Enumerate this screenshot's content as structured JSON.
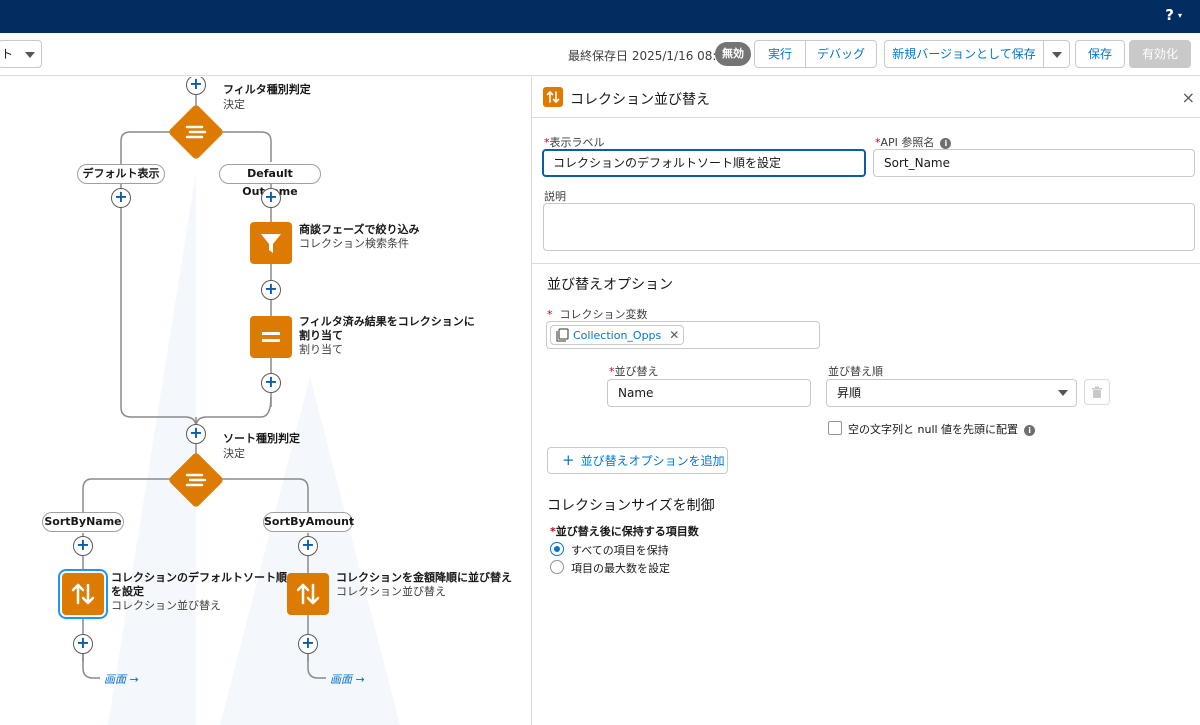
{
  "topbar": {
    "help_label": "?",
    "help_caret": "▾"
  },
  "toolbar": {
    "left_select_text": "ト",
    "last_saved": "最終保存日 2025/1/16 08:55",
    "status_badge": "無効",
    "run_label": "実行",
    "debug_label": "デバッグ",
    "save_new_version_label": "新規バージョンとして保存",
    "save_label": "保存",
    "activate_label": "有効化"
  },
  "canvas": {
    "filter_decision": {
      "title": "フィルタ種別判定",
      "subtitle": "決定"
    },
    "branch_default_display": "デフォルト表示",
    "branch_default_outcome": "Default Outcome",
    "filter_node": {
      "title": "商談フェーズで絞り込み",
      "subtitle": "コレクション検索条件"
    },
    "assign_node": {
      "title_line1": "フィルタ済み結果をコレクションに",
      "title_line2": "割り当て",
      "subtitle": "割り当て"
    },
    "sort_decision": {
      "title": "ソート種別判定",
      "subtitle": "決定"
    },
    "branch_sort_by_name": "SortByName",
    "branch_sort_by_amount": "SortByAmount",
    "sort_name_node": {
      "title_line1": "コレクションのデフォルトソート順",
      "title_line2": "を設定",
      "subtitle": "コレクション並び替え"
    },
    "sort_amount_node": {
      "title": "コレクションを金額降順に並び替え",
      "subtitle": "コレクション並び替え"
    },
    "screen_link_1": "画面 →",
    "screen_link_2": "画面 →",
    "plus_symbol": "+"
  },
  "panel": {
    "title": "コレクション並び替え",
    "close_symbol": "×",
    "label_field": {
      "label": "表示ラベル",
      "value": "コレクションのデフォルトソート順を設定"
    },
    "api_field": {
      "label": "API 参照名",
      "value": "Sort_Name"
    },
    "description_label": "説明",
    "sort_options_title": "並び替えオプション",
    "collection_var_label": "コレクション変数",
    "collection_var_value": "Collection_Opps",
    "sort_by_label": "並び替え",
    "sort_by_value": "Name",
    "sort_order_label": "並び替え順",
    "sort_order_value": "昇順",
    "nulls_first_label": "空の文字列と null 値を先頭に配置",
    "add_option_label": "並び替えオプションを追加",
    "size_control_title": "コレクションサイズを制御",
    "keep_items_label": "並び替え後に保持する項目数",
    "radio_keep_all": "すべての項目を保持",
    "radio_set_max": "項目の最大数を設定",
    "required_mark": "*",
    "info_symbol": "i",
    "x_symbol": "✕",
    "plus_symbol": "+"
  },
  "colors": {
    "brand_navy": "#032d60",
    "node_orange": "#dd7a01",
    "link_blue": "#0176d3",
    "focus_blue": "#0b5cab"
  }
}
